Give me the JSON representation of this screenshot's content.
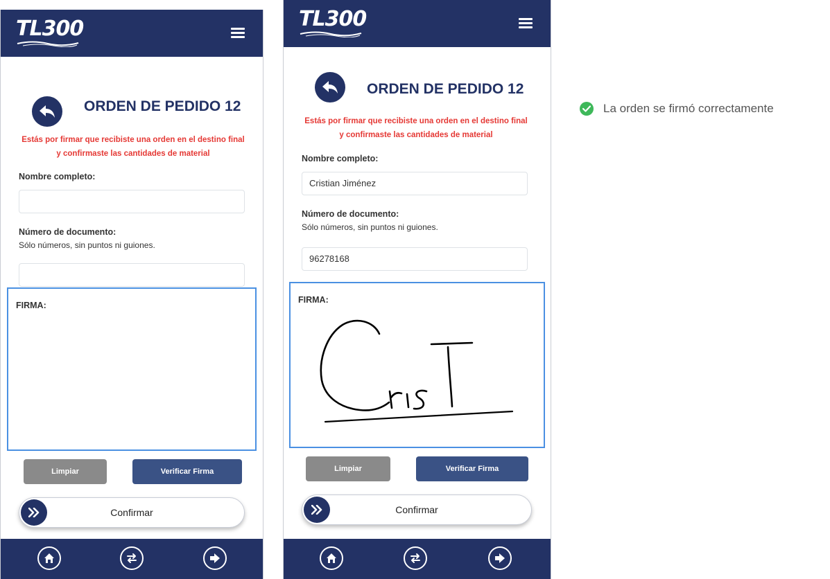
{
  "app": {
    "logo_text": "TL300",
    "menu_icon": "hamburger-icon"
  },
  "screens": [
    {
      "title": "ORDEN DE PEDIDO 12",
      "warning": "Estás por firmar que recibiste una orden en el destino final y confirmaste las cantidades de material",
      "name_label": "Nombre completo:",
      "name_value": "",
      "doc_label": "Número de documento:",
      "doc_hint": "Sólo números, sin puntos ni guiones.",
      "doc_value": "",
      "signature_label": "FIRMA:",
      "signature_drawn": false,
      "clear_button": "Limpiar",
      "verify_button": "Verificar Firma",
      "confirm_slider": "Confirmar"
    },
    {
      "title": "ORDEN DE PEDIDO 12",
      "warning": "Estás por firmar que recibiste una orden en el destino final y confirmaste las cantidades de material",
      "name_label": "Nombre completo:",
      "name_value": "Cristian Jiménez",
      "doc_label": "Número de documento:",
      "doc_hint": "Sólo números, sin puntos ni guiones.",
      "doc_value": "96278168",
      "signature_label": "FIRMA:",
      "signature_drawn": true,
      "clear_button": "Limpiar",
      "verify_button": "Verificar Firma",
      "confirm_slider": "Confirmar"
    }
  ],
  "bottom_nav": [
    "home-icon",
    "swap-icon",
    "logout-icon"
  ],
  "toast": {
    "message": "La orden se firmó correctamente",
    "icon": "check-circle-icon"
  },
  "colors": {
    "navy": "#233265",
    "warning_red": "#e53935",
    "pad_border": "#4a90e2",
    "clear_gray": "#8a8a8a",
    "verify_blue": "#3a5285",
    "success_green": "#3eb85a"
  }
}
